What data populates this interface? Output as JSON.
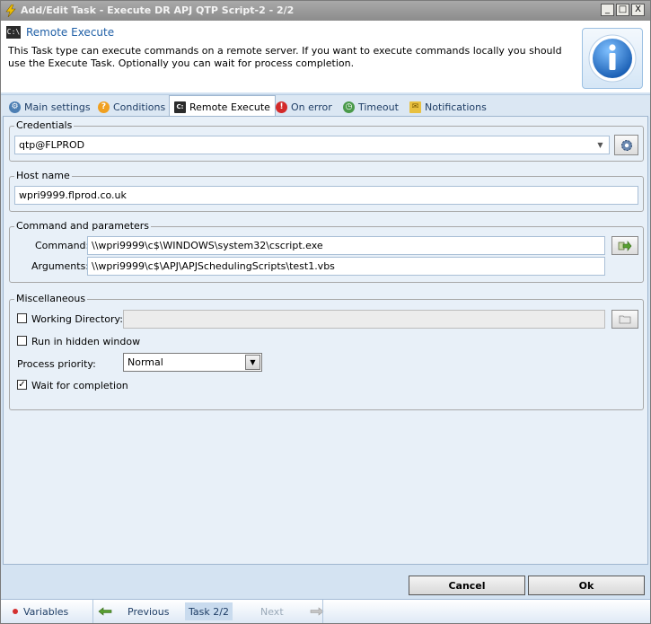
{
  "window": {
    "title": "Add/Edit Task - Execute DR APJ QTP Script-2 - 2/2",
    "controls": [
      "_",
      "□",
      "X"
    ]
  },
  "header": {
    "icon_text": "C:\\",
    "title": "Remote Execute",
    "description": "This Task type can execute commands on a remote server. If you want to execute commands locally you should use the Execute Task. Optionally you can wait for process completion."
  },
  "tabs": [
    {
      "label": "Main settings",
      "icon": "gears-icon",
      "active": false
    },
    {
      "label": "Conditions",
      "icon": "question-icon",
      "active": false
    },
    {
      "label": "Remote Execute",
      "icon": "console-icon",
      "active": true
    },
    {
      "label": "On error",
      "icon": "error-icon",
      "active": false
    },
    {
      "label": "Timeout",
      "icon": "clock-icon",
      "active": false
    },
    {
      "label": "Notifications",
      "icon": "envelope-icon",
      "active": false
    }
  ],
  "credentials": {
    "legend": "Credentials",
    "value": "qtp@FLPROD"
  },
  "host": {
    "legend": "Host name",
    "value": "wpri9999.flprod.co.uk"
  },
  "command": {
    "legend": "Command and parameters",
    "command_label": "Command:",
    "command_value": "\\\\wpri9999\\c$\\WINDOWS\\system32\\cscript.exe",
    "arguments_label": "Arguments:",
    "arguments_value": "\\\\wpri9999\\c$\\APJ\\APJSchedulingScripts\\test1.vbs"
  },
  "misc": {
    "legend": "Miscellaneous",
    "working_dir_label": "Working Directory:",
    "working_dir_checked": false,
    "working_dir_value": "",
    "hidden_label": "Run in hidden window",
    "hidden_checked": false,
    "priority_label": "Process priority:",
    "priority_value": "Normal",
    "wait_label": "Wait for completion",
    "wait_checked": true
  },
  "footer": {
    "cancel_label": "Cancel",
    "ok_label": "Ok"
  },
  "navbar": {
    "variables_label": "Variables",
    "previous_label": "Previous",
    "task_label": "Task 2/2",
    "next_label": "Next"
  },
  "colors": {
    "accent": "#1f5fa6",
    "background": "#e8f0f8",
    "titlebar": "#999999"
  }
}
